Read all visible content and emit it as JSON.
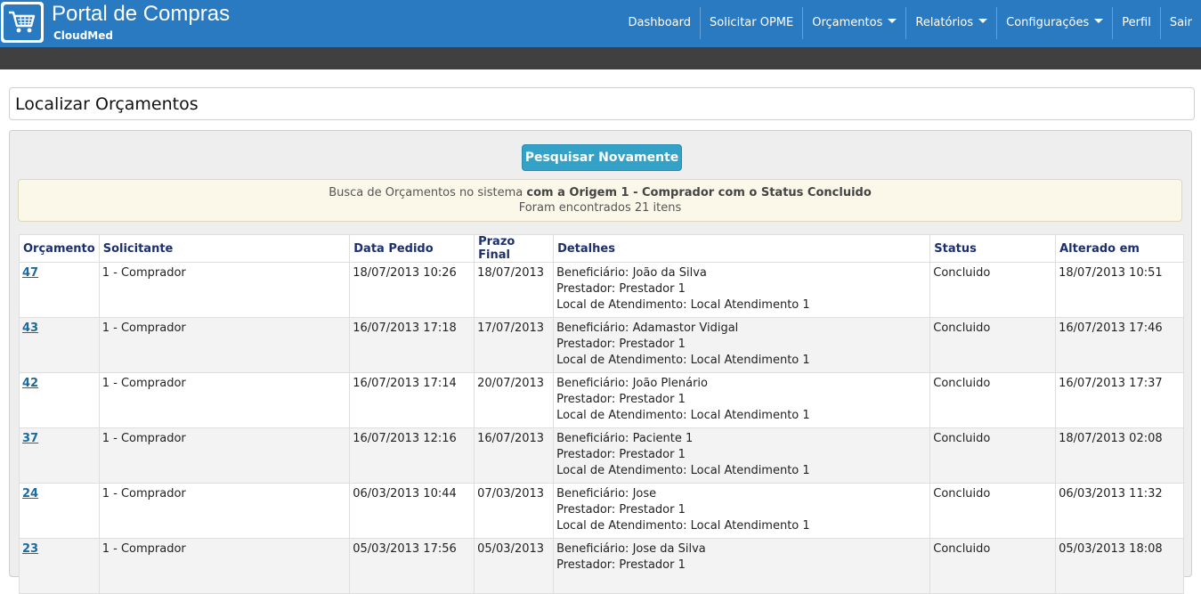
{
  "brand": {
    "title": "Portal de Compras",
    "subtitle": "CloudMed"
  },
  "nav": {
    "items": [
      {
        "label": "Dashboard",
        "dropdown": false
      },
      {
        "label": "Solicitar OPME",
        "dropdown": false
      },
      {
        "label": "Orçamentos",
        "dropdown": true
      },
      {
        "label": "Relatórios",
        "dropdown": true
      },
      {
        "label": "Configurações",
        "dropdown": true
      },
      {
        "label": "Perfil",
        "dropdown": false
      },
      {
        "label": "Sair",
        "dropdown": false
      }
    ]
  },
  "page": {
    "title": "Localizar Orçamentos"
  },
  "search_button": {
    "label": "Pesquisar Novamente"
  },
  "alert": {
    "prefix": "Busca de Orçamentos no sistema",
    "criteria": "com a Origem 1 - Comprador com o Status Concluido",
    "count_text": "Foram encontrados 21 itens"
  },
  "table": {
    "headers": [
      "Orçamento",
      "Solicitante",
      "Data Pedido",
      "Prazo Final",
      "Detalhes",
      "Status",
      "Alterado em"
    ],
    "rows": [
      {
        "id": "47",
        "solicitante": "1 - Comprador",
        "data_pedido": "18/07/2013 10:26",
        "prazo_final": "18/07/2013",
        "beneficiario": "Beneficiário: João da Silva",
        "prestador": "Prestador: Prestador 1",
        "local": "Local de Atendimento: Local Atendimento 1",
        "status": "Concluido",
        "alterado": "18/07/2013 10:51"
      },
      {
        "id": "43",
        "solicitante": "1 - Comprador",
        "data_pedido": "16/07/2013 17:18",
        "prazo_final": "17/07/2013",
        "beneficiario": "Beneficiário: Adamastor Vidigal",
        "prestador": "Prestador: Prestador 1",
        "local": "Local de Atendimento: Local Atendimento 1",
        "status": "Concluido",
        "alterado": "16/07/2013 17:46"
      },
      {
        "id": "42",
        "solicitante": "1 - Comprador",
        "data_pedido": "16/07/2013 17:14",
        "prazo_final": "20/07/2013",
        "beneficiario": "Beneficiário: João Plenário",
        "prestador": "Prestador: Prestador 1",
        "local": "Local de Atendimento: Local Atendimento 1",
        "status": "Concluido",
        "alterado": "16/07/2013 17:37"
      },
      {
        "id": "37",
        "solicitante": "1 - Comprador",
        "data_pedido": "16/07/2013 12:16",
        "prazo_final": "16/07/2013",
        "beneficiario": "Beneficiário: Paciente 1",
        "prestador": "Prestador: Prestador 1",
        "local": "Local de Atendimento: Local Atendimento 1",
        "status": "Concluido",
        "alterado": "18/07/2013 02:08"
      },
      {
        "id": "24",
        "solicitante": "1 - Comprador",
        "data_pedido": "06/03/2013 10:44",
        "prazo_final": "07/03/2013",
        "beneficiario": "Beneficiário: Jose",
        "prestador": "Prestador: Prestador 1",
        "local": "Local de Atendimento: Local Atendimento 1",
        "status": "Concluido",
        "alterado": "06/03/2013 11:32"
      },
      {
        "id": "23",
        "solicitante": "1 - Comprador",
        "data_pedido": "05/03/2013 17:56",
        "prazo_final": "05/03/2013",
        "beneficiario": "Beneficiário: Jose da Silva",
        "prestador": "Prestador: Prestador 1",
        "local": "",
        "status": "Concluido",
        "alterado": "05/03/2013 18:08"
      }
    ]
  },
  "colors": {
    "topbar": "#2a7ac2",
    "subbar": "#404040",
    "button": "#34a1c6",
    "header_text": "#1c2f6e",
    "link": "#1a6aa0"
  },
  "icons": {
    "logo": "shopping-cart-icon",
    "dropdown": "caret-down-icon"
  }
}
